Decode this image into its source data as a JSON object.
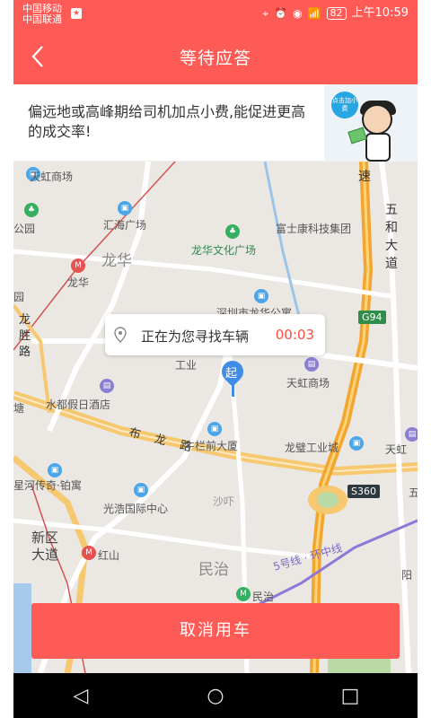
{
  "status": {
    "carrier1": "中国移动",
    "carrier2": "中国联通",
    "battery": "82",
    "time": "上午10:59"
  },
  "header": {
    "title": "等待应答"
  },
  "tip": {
    "text": "偏远地或高峰期给司机加点小费,能促进更高的成交率!",
    "bubble": "点击加小费"
  },
  "map": {
    "labels": [
      "天虹商场",
      "汇海广场",
      "龙华",
      "龙华文化广场",
      "富士康科技集团",
      "龙华",
      "深圳市龙华公寓",
      "工业",
      "天虹商场",
      "水都假日酒店",
      "布 龙 路",
      "牛栏前大厦",
      "龙璧工业城",
      "天虹",
      "星河传奇·铂寓",
      "光浩国际中心",
      "沙吓",
      "红山",
      "民治",
      "民治",
      "5号线 · 环中线",
      "新区大道",
      "阳",
      "五和大道",
      "龙胜路",
      "速",
      "园",
      "公园",
      "塘",
      "五"
    ],
    "shields": [
      "G94",
      "S360"
    ]
  },
  "search": {
    "text": "正在为您寻找车辆",
    "timer": "00:03"
  },
  "pin": {
    "label": "起"
  },
  "actions": {
    "cancel": "取消用车"
  },
  "colors": {
    "brand": "#ff5b56",
    "timer": "#ff4a3d"
  }
}
